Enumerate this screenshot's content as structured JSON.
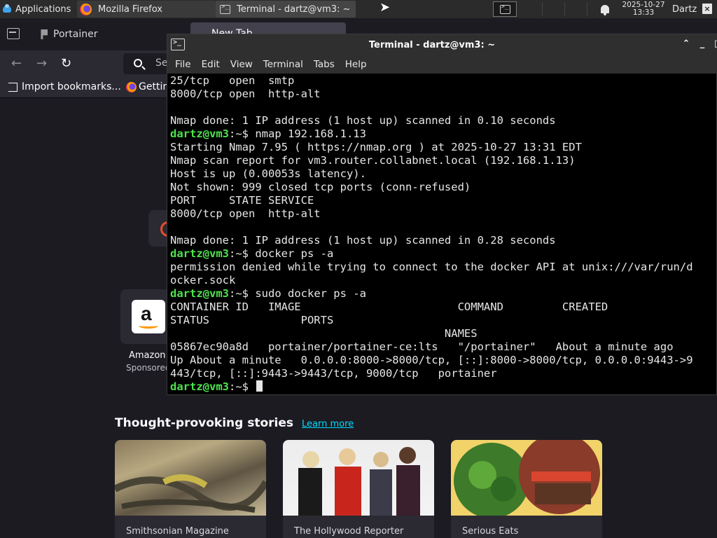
{
  "panel": {
    "apps_label": "Applications",
    "tasks": [
      {
        "label": "Mozilla Firefox",
        "icon": "firefox-icon"
      },
      {
        "label": "Terminal - dartz@vm3: ~",
        "icon": "terminal-icon"
      }
    ],
    "clock_date": "2025-10-27",
    "clock_time": "13:33",
    "user": "Dartz",
    "close_glyph": "×"
  },
  "firefox": {
    "tab_portainer": "Portainer",
    "tab_newtab": "New Tab",
    "search_placeholder": "Se",
    "bookmarks": [
      "Import bookmarks...",
      "Getting Started"
    ],
    "shortcut_label": "Amazon",
    "shortcut_sublabel": "Sponsored",
    "stories_heading": "Thought-provoking stories",
    "learn_more": "Learn more",
    "cards": [
      {
        "source": "Smithsonian Magazine"
      },
      {
        "source": "The Hollywood Reporter"
      },
      {
        "source": "Serious Eats"
      }
    ]
  },
  "terminal": {
    "title": "Terminal - dartz@vm3: ~",
    "menu": [
      "File",
      "Edit",
      "View",
      "Terminal",
      "Tabs",
      "Help"
    ],
    "prompt_user": "dartz@vm3",
    "prompt_path": ":~$ ",
    "lines": [
      {
        "text": "25/tcp   open  smtp"
      },
      {
        "text": "8000/tcp open  http-alt"
      },
      {
        "text": ""
      },
      {
        "text": "Nmap done: 1 IP address (1 host up) scanned in 0.10 seconds"
      },
      {
        "prompt": true,
        "cmd": "nmap 192.168.1.13"
      },
      {
        "text": "Starting Nmap 7.95 ( https://nmap.org ) at 2025-10-27 13:31 EDT"
      },
      {
        "text": "Nmap scan report for vm3.router.collabnet.local (192.168.1.13)"
      },
      {
        "text": "Host is up (0.00053s latency)."
      },
      {
        "text": "Not shown: 999 closed tcp ports (conn-refused)"
      },
      {
        "text": "PORT     STATE SERVICE"
      },
      {
        "text": "8000/tcp open  http-alt"
      },
      {
        "text": ""
      },
      {
        "text": "Nmap done: 1 IP address (1 host up) scanned in 0.28 seconds"
      },
      {
        "prompt": true,
        "cmd": "docker ps -a"
      },
      {
        "text": "permission denied while trying to connect to the docker API at unix:///var/run/d"
      },
      {
        "text": "ocker.sock"
      },
      {
        "prompt": true,
        "cmd": "sudo docker ps -a"
      },
      {
        "text": "CONTAINER ID   IMAGE                        COMMAND         CREATED"
      },
      {
        "text": "STATUS              PORTS"
      },
      {
        "text": "                                          NAMES"
      },
      {
        "text": "05867ec90a8d   portainer/portainer-ce:lts   \"/portainer\"   About a minute ago"
      },
      {
        "text": "Up About a minute   0.0.0.0:8000->8000/tcp, [::]:8000->8000/tcp, 0.0.0.0:9443->9"
      },
      {
        "text": "443/tcp, [::]:9443->9443/tcp, 9000/tcp   portainer"
      },
      {
        "prompt": true,
        "cmd": "",
        "cursor": true
      }
    ]
  }
}
